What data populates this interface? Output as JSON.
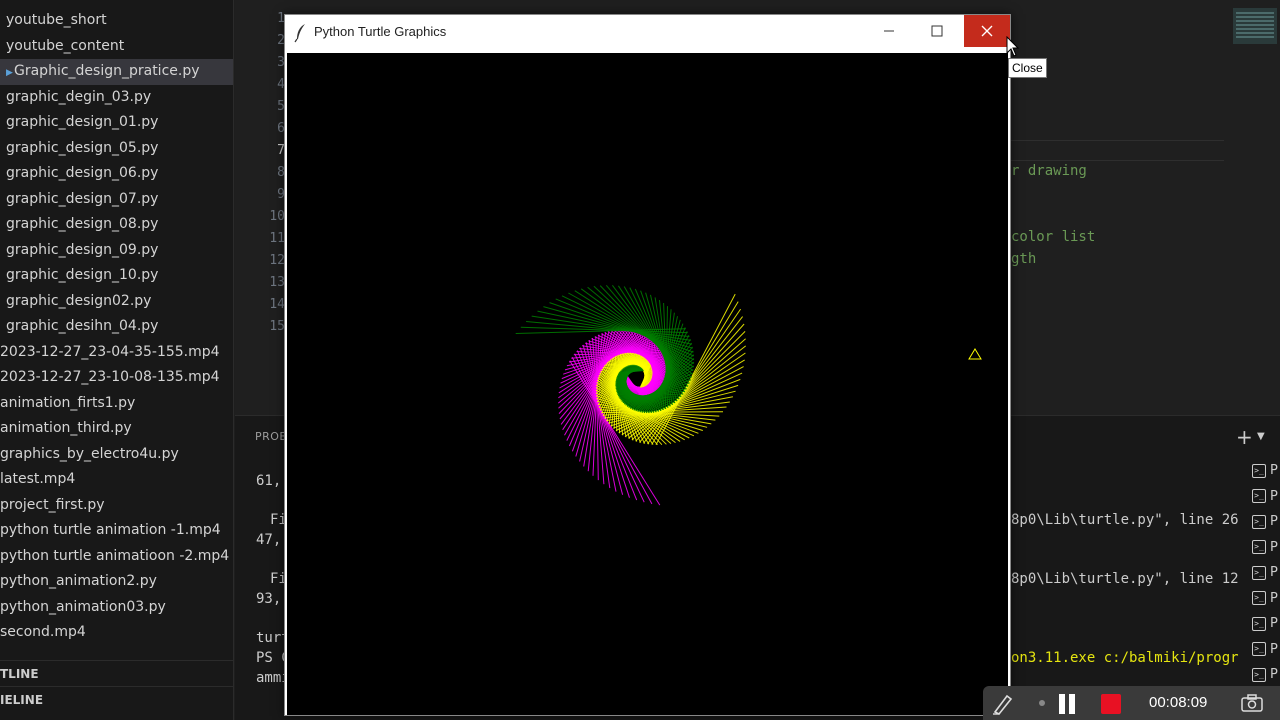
{
  "sidebar": {
    "files": [
      {
        "label": "youtube_short",
        "active": false
      },
      {
        "label": "youtube_content",
        "active": false
      },
      {
        "label": "Graphic_design_pratice.py",
        "active": true
      },
      {
        "label": "graphic_degin_03.py",
        "active": false
      },
      {
        "label": "graphic_design_01.py",
        "active": false
      },
      {
        "label": "graphic_design_05.py",
        "active": false
      },
      {
        "label": "graphic_design_06.py",
        "active": false
      },
      {
        "label": "graphic_design_07.py",
        "active": false
      },
      {
        "label": "graphic_design_08.py",
        "active": false
      },
      {
        "label": "graphic_design_09.py",
        "active": false
      },
      {
        "label": "graphic_design_10.py",
        "active": false
      },
      {
        "label": "graphic_design02.py",
        "active": false
      },
      {
        "label": "graphic_desihn_04.py",
        "active": false
      },
      {
        "label": "2023-12-27_23-04-35-155.mp4",
        "active": false
      },
      {
        "label": "2023-12-27_23-10-08-135.mp4",
        "active": false
      },
      {
        "label": "animation_firts1.py",
        "active": false
      },
      {
        "label": "animation_third.py",
        "active": false
      },
      {
        "label": "graphics_by_electro4u.py",
        "active": false
      },
      {
        "label": "latest.mp4",
        "active": false
      },
      {
        "label": "project_first.py",
        "active": false
      },
      {
        "label": "python turtle animation -1.mp4",
        "active": false
      },
      {
        "label": "python turtle animatioon -2.mp4",
        "active": false
      },
      {
        "label": "python_animation2.py",
        "active": false
      },
      {
        "label": "python_animation03.py",
        "active": false
      },
      {
        "label": "second.mp4",
        "active": false
      }
    ],
    "outline_label": "TLINE",
    "timeline_label": "IELINE"
  },
  "editor": {
    "line_numbers": [
      "1",
      "2",
      "3",
      "4",
      "5",
      "6",
      "7",
      "8",
      "9",
      "10",
      "11",
      "12",
      "13",
      "14",
      "15"
    ],
    "current_line": "7",
    "code_fragments": {
      "frag_drawing": "r drawing",
      "frag_color": " color list",
      "frag_length": "gth"
    }
  },
  "panel": {
    "tab_label": "PROB",
    "lines": {
      "l1": "61,",
      "l2": "Fi",
      "l3": "47,",
      "l4": "Fi",
      "l5": "93,",
      "l6": "turt",
      "l7": "PS C",
      "l8": "ammi",
      "r1": "8p0\\Lib\\turtle.py\", line 26",
      "r2": "8p0\\Lib\\turtle.py\", line 12",
      "r3": "on3.11.exe c:/balmiki/progr"
    },
    "add_icon": "+",
    "terminal_items": [
      "P",
      "P",
      "P",
      "P",
      "P",
      "P",
      "P",
      "P",
      "P"
    ]
  },
  "turtle_window": {
    "title": "Python Turtle Graphics",
    "close_tooltip": "Close",
    "colors": {
      "yellow": "#ffff00",
      "magenta": "#ff00ff",
      "green": "#008000",
      "background": "#000000"
    }
  },
  "recorder": {
    "time": "00:08:09"
  }
}
